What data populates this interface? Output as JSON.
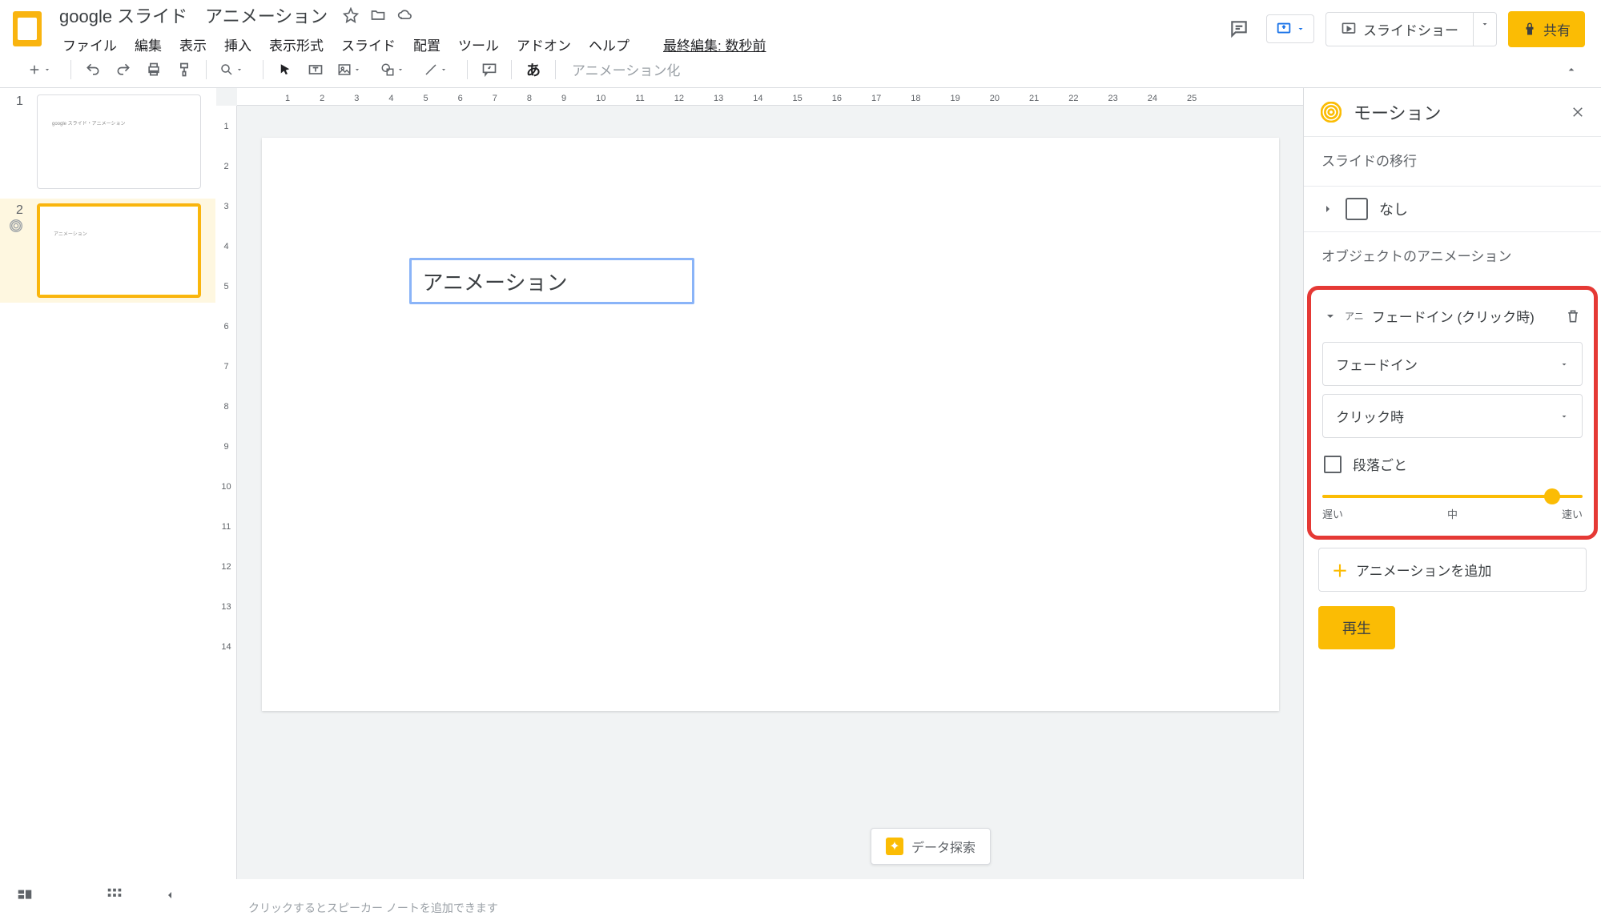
{
  "doc": {
    "title": "google スライド　アニメーション",
    "last_edit": "最終編集: 数秒前"
  },
  "menu": {
    "file": "ファイル",
    "edit": "編集",
    "view": "表示",
    "insert": "挿入",
    "format": "表示形式",
    "slide": "スライド",
    "arrange": "配置",
    "tools": "ツール",
    "addons": "アドオン",
    "help": "ヘルプ"
  },
  "title_actions": {
    "slideshow": "スライドショー",
    "share": "共有"
  },
  "toolbar": {
    "animate": "アニメーション化"
  },
  "slides": {
    "s1_num": "1",
    "s2_num": "2",
    "thumb1_text": "google スライド・アニメーション",
    "thumb2_text": "アニメーション"
  },
  "canvas": {
    "textbox": "アニメーション"
  },
  "ruler_h": [
    "1",
    "2",
    "3",
    "4",
    "5",
    "6",
    "7",
    "8",
    "9",
    "10",
    "11",
    "12",
    "13",
    "14",
    "15",
    "16",
    "17",
    "18",
    "19",
    "20",
    "21",
    "22",
    "23",
    "24",
    "25"
  ],
  "ruler_v": [
    "1",
    "2",
    "3",
    "4",
    "5",
    "6",
    "7",
    "8",
    "9",
    "10",
    "11",
    "12",
    "13",
    "14"
  ],
  "motion": {
    "title": "モーション",
    "transition_section": "スライドの移行",
    "transition_none": "なし",
    "object_section": "オブジェクトのアニメーション",
    "anim_badge": "アニ",
    "anim_title": "フェードイン (クリック時)",
    "dd_effect": "フェードイン",
    "dd_trigger": "クリック時",
    "by_paragraph": "段落ごと",
    "speed_slow": "遅い",
    "speed_mid": "中",
    "speed_fast": "速い",
    "add_animation": "アニメーションを追加",
    "play": "再生"
  },
  "bottom": {
    "explore": "データ探索",
    "hint": "クリックするとスピーカー ノートを追加できます"
  }
}
